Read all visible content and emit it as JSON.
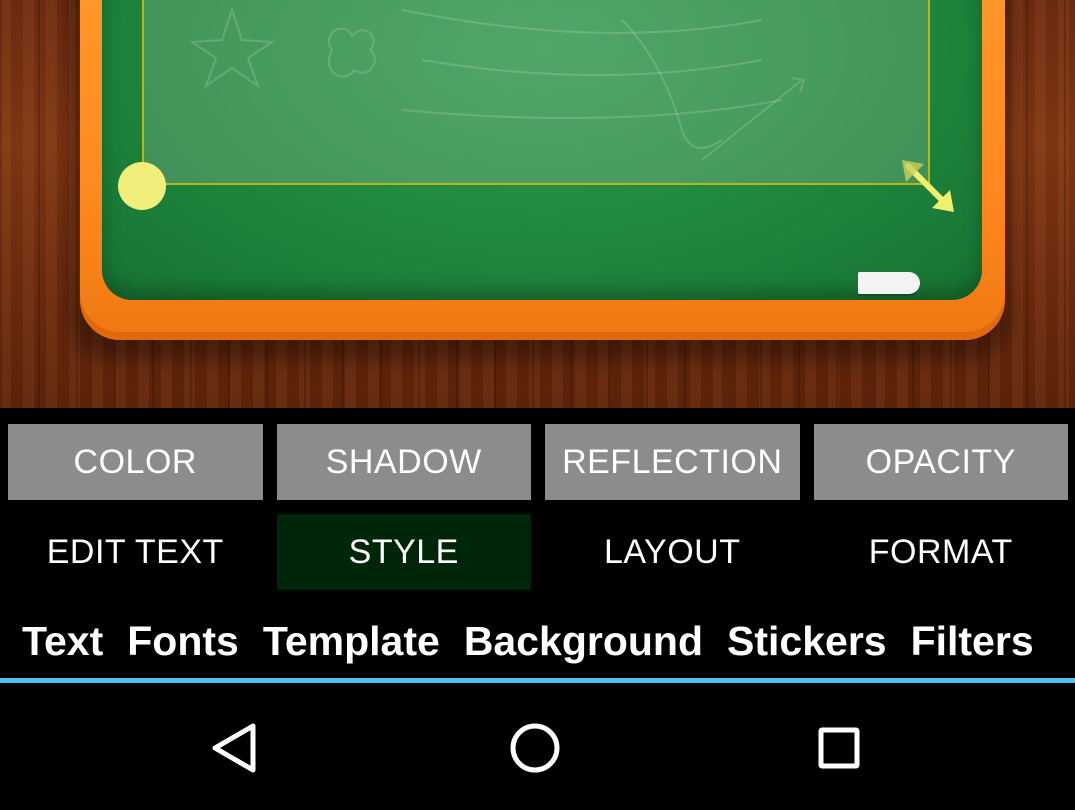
{
  "style_options": [
    {
      "label": "COLOR"
    },
    {
      "label": "SHADOW"
    },
    {
      "label": "REFLECTION"
    },
    {
      "label": "OPACITY"
    }
  ],
  "sub_tabs": [
    {
      "label": "EDIT TEXT",
      "active": false
    },
    {
      "label": "STYLE",
      "active": true
    },
    {
      "label": "LAYOUT",
      "active": false
    },
    {
      "label": "FORMAT",
      "active": false
    }
  ],
  "main_tabs": [
    {
      "label": "Text"
    },
    {
      "label": "Fonts"
    },
    {
      "label": "Template"
    },
    {
      "label": "Background"
    },
    {
      "label": "Stickers"
    },
    {
      "label": "Filters"
    }
  ],
  "navbar": {
    "icons": [
      "back-icon",
      "home-icon",
      "recents-icon"
    ]
  },
  "colors": {
    "accent_indicator": "#4fc3f7",
    "active_tab_bg": "#00260a",
    "option_button_bg": "#8c8c8c",
    "board_frame": "#ff8a1f",
    "board_green": "#218a3e"
  }
}
